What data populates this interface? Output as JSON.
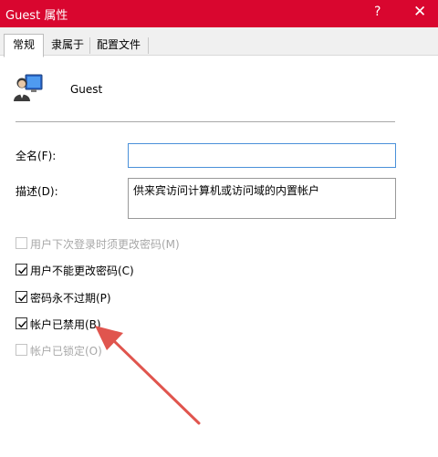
{
  "window": {
    "title": "Guest 属性",
    "help_glyph": "?",
    "close_glyph": "✕"
  },
  "tabs": [
    {
      "label": "常规",
      "active": true
    },
    {
      "label": "隶属于",
      "active": false
    },
    {
      "label": "配置文件",
      "active": false
    }
  ],
  "user": {
    "name": "Guest"
  },
  "fields": {
    "fullname": {
      "label": "全名(F):",
      "value": ""
    },
    "description": {
      "label": "描述(D):",
      "value": "供来宾访问计算机或访问域的内置帐户"
    }
  },
  "checkboxes": [
    {
      "label": "用户下次登录时须更改密码(M)",
      "checked": false,
      "enabled": false
    },
    {
      "label": "用户不能更改密码(C)",
      "checked": true,
      "enabled": true
    },
    {
      "label": "密码永不过期(P)",
      "checked": true,
      "enabled": true
    },
    {
      "label": "帐户已禁用(B)",
      "checked": true,
      "enabled": true
    },
    {
      "label": "帐户已锁定(O)",
      "checked": false,
      "enabled": false
    }
  ],
  "colors": {
    "titlebar": "#d9062f",
    "annotation_arrow": "#e0554e",
    "focus_border": "#4a90d9"
  },
  "icons": {
    "user": "user-account-icon",
    "check": "check-icon",
    "annotation": "annotation-arrow"
  }
}
